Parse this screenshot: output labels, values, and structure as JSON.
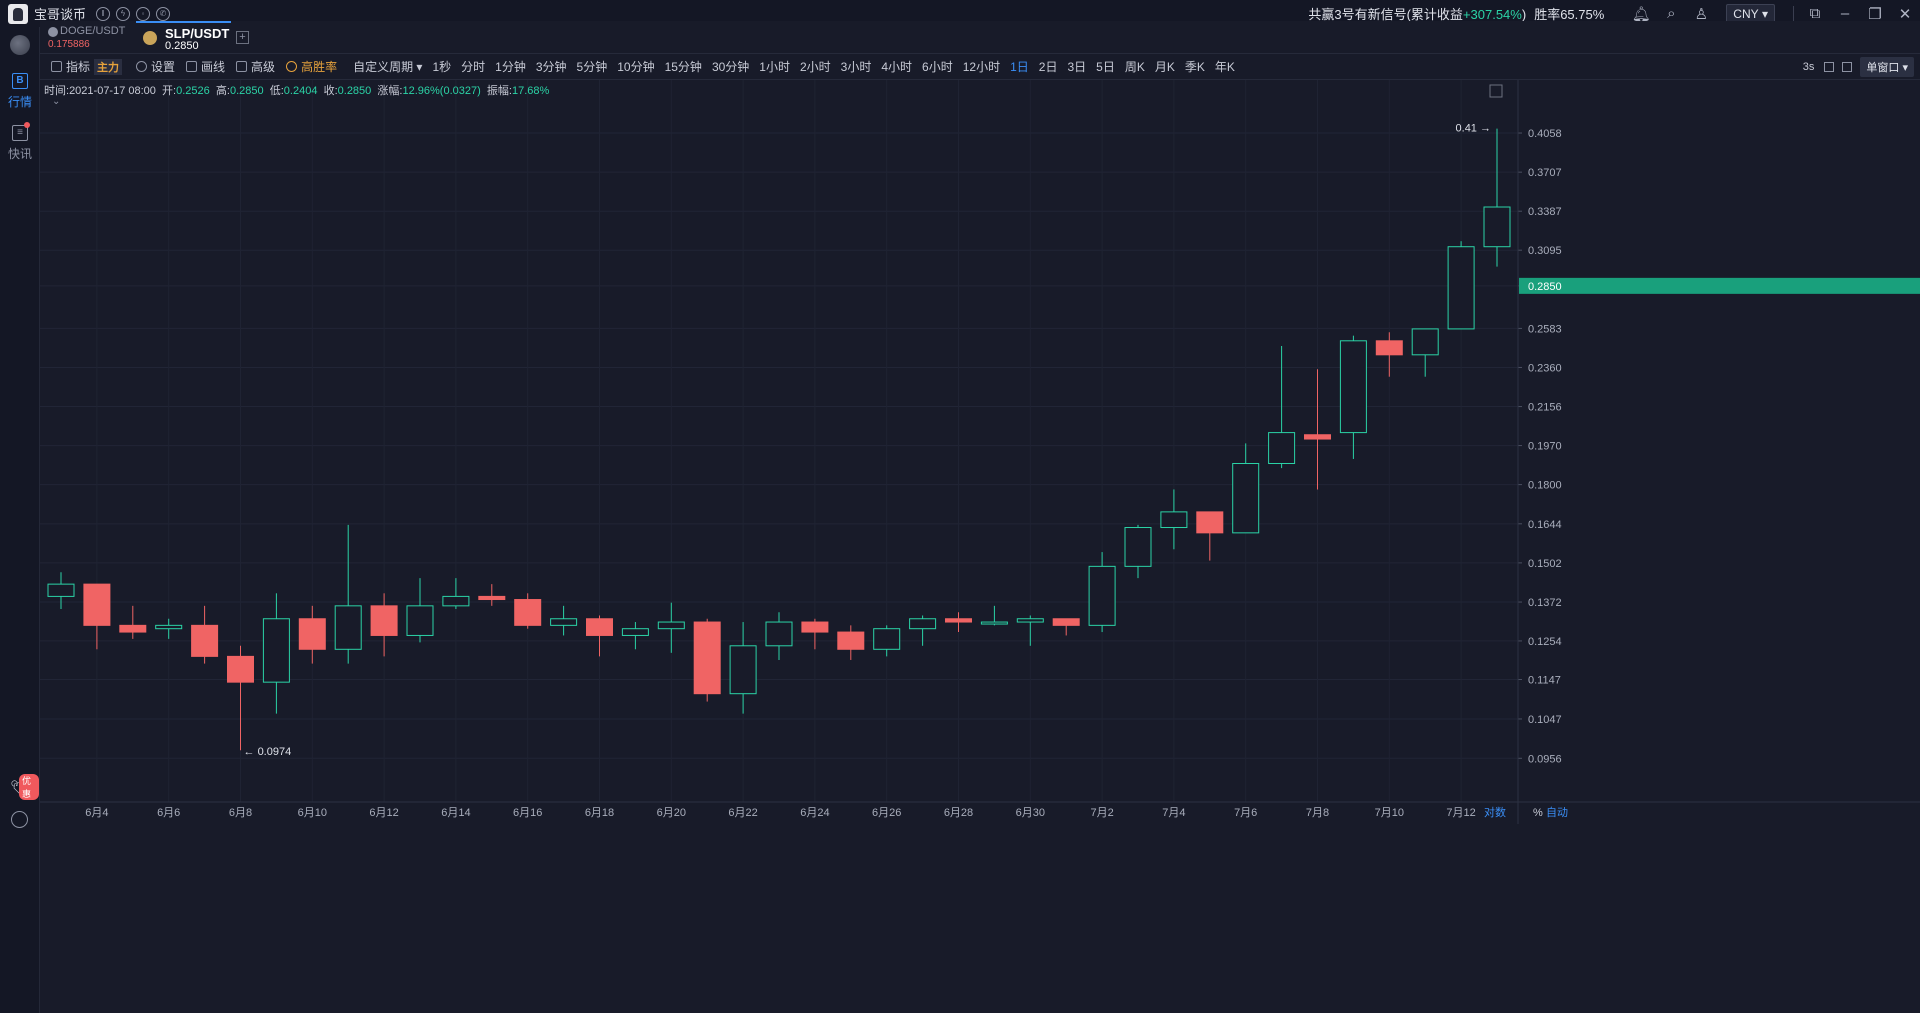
{
  "app": {
    "name": "宝哥谈币",
    "signal_text": "共赢3号有新信号(累计收益",
    "signal_gain": "+307.54%",
    "signal_close": ")",
    "winrate": "胜率65.75%",
    "currency": "CNY"
  },
  "leftnav": {
    "market": "行情",
    "news": "快讯",
    "promo_badge": "优惠"
  },
  "tabs": [
    {
      "symbol": "DOGE/USDT",
      "price": "0.175886"
    },
    {
      "symbol": "SLP/USDT",
      "price": "0.2850"
    }
  ],
  "toolbar": {
    "indicator": "指标",
    "indicator_tag": "主力",
    "settings": "设置",
    "draw": "画线",
    "advanced": "高级",
    "high_win": "高胜率",
    "custom_period": "自定义周期",
    "periods": [
      "1秒",
      "分时",
      "1分钟",
      "3分钟",
      "5分钟",
      "10分钟",
      "15分钟",
      "30分钟",
      "1小时",
      "2小时",
      "3小时",
      "4小时",
      "6小时",
      "12小时",
      "1日",
      "2日",
      "3日",
      "5日",
      "周K",
      "月K",
      "季K",
      "年K"
    ],
    "active_period": "1日",
    "refresh": "3s",
    "window_mode": "单窗口"
  },
  "info": {
    "time_label": "时间:",
    "time": "2021-07-17 08:00",
    "open_label": "开:",
    "open": "0.2526",
    "high_label": "高:",
    "high": "0.2850",
    "low_label": "低:",
    "low": "0.2404",
    "close_label": "收:",
    "close": "0.2850",
    "change_label": "涨幅:",
    "change": "12.96%(0.0327)",
    "amp_label": "振幅:",
    "amp": "17.68%"
  },
  "chart_footer": {
    "log": "对数",
    "pct": "%",
    "auto": "自动"
  },
  "colors": {
    "up": "#2bd3a6",
    "down": "#f06464",
    "accent": "#3a8ef5",
    "gold": "#e6a23c",
    "bg": "#181b29"
  },
  "chart_data": {
    "type": "candlestick",
    "title": "SLP/USDT",
    "last_price": "0.2850",
    "y_ticks": [
      "0.4058",
      "0.3707",
      "0.3387",
      "0.3095",
      "0.2850",
      "0.2583",
      "0.2360",
      "0.2156",
      "0.1970",
      "0.1800",
      "0.1644",
      "0.1502",
      "0.1372",
      "0.1254",
      "0.1147",
      "0.1047",
      "0.0956"
    ],
    "x_ticks": [
      "6月4",
      "6月6",
      "6月8",
      "6月10",
      "6月12",
      "6月14",
      "6月16",
      "6月18",
      "6月20",
      "6月22",
      "6月24",
      "6月26",
      "6月28",
      "6月30",
      "7月2",
      "7月4",
      "7月6",
      "7月8",
      "7月10",
      "7月12"
    ],
    "max_label": "0.41",
    "min_label": "0.0974",
    "scale": "log",
    "candles": [
      {
        "date": "6月3",
        "o": 0.139,
        "h": 0.147,
        "l": 0.135,
        "c": 0.143
      },
      {
        "date": "6月4",
        "o": 0.143,
        "h": 0.143,
        "l": 0.123,
        "c": 0.13
      },
      {
        "date": "6月5",
        "o": 0.13,
        "h": 0.136,
        "l": 0.126,
        "c": 0.128
      },
      {
        "date": "6月6",
        "o": 0.129,
        "h": 0.132,
        "l": 0.126,
        "c": 0.13
      },
      {
        "date": "6月7",
        "o": 0.13,
        "h": 0.136,
        "l": 0.119,
        "c": 0.121
      },
      {
        "date": "6月8",
        "o": 0.121,
        "h": 0.124,
        "l": 0.0974,
        "c": 0.114
      },
      {
        "date": "6月9",
        "o": 0.114,
        "h": 0.14,
        "l": 0.106,
        "c": 0.132
      },
      {
        "date": "6月10",
        "o": 0.132,
        "h": 0.136,
        "l": 0.119,
        "c": 0.123
      },
      {
        "date": "6月11",
        "o": 0.123,
        "h": 0.164,
        "l": 0.119,
        "c": 0.136
      },
      {
        "date": "6月12",
        "o": 0.136,
        "h": 0.14,
        "l": 0.121,
        "c": 0.127
      },
      {
        "date": "6月13",
        "o": 0.127,
        "h": 0.145,
        "l": 0.125,
        "c": 0.136
      },
      {
        "date": "6月14",
        "o": 0.136,
        "h": 0.145,
        "l": 0.135,
        "c": 0.139
      },
      {
        "date": "6月15",
        "o": 0.139,
        "h": 0.143,
        "l": 0.136,
        "c": 0.138
      },
      {
        "date": "6月16",
        "o": 0.138,
        "h": 0.14,
        "l": 0.129,
        "c": 0.13
      },
      {
        "date": "6月17",
        "o": 0.13,
        "h": 0.136,
        "l": 0.127,
        "c": 0.132
      },
      {
        "date": "6月18",
        "o": 0.132,
        "h": 0.133,
        "l": 0.121,
        "c": 0.127
      },
      {
        "date": "6月19",
        "o": 0.127,
        "h": 0.131,
        "l": 0.123,
        "c": 0.129
      },
      {
        "date": "6月20",
        "o": 0.129,
        "h": 0.137,
        "l": 0.122,
        "c": 0.131
      },
      {
        "date": "6月21",
        "o": 0.131,
        "h": 0.132,
        "l": 0.109,
        "c": 0.111
      },
      {
        "date": "6月22",
        "o": 0.111,
        "h": 0.131,
        "l": 0.106,
        "c": 0.124
      },
      {
        "date": "6月23",
        "o": 0.124,
        "h": 0.134,
        "l": 0.12,
        "c": 0.131
      },
      {
        "date": "6月24",
        "o": 0.131,
        "h": 0.132,
        "l": 0.123,
        "c": 0.128
      },
      {
        "date": "6月25",
        "o": 0.128,
        "h": 0.13,
        "l": 0.12,
        "c": 0.123
      },
      {
        "date": "6月26",
        "o": 0.123,
        "h": 0.13,
        "l": 0.121,
        "c": 0.129
      },
      {
        "date": "6月27",
        "o": 0.129,
        "h": 0.133,
        "l": 0.124,
        "c": 0.132
      },
      {
        "date": "6月28",
        "o": 0.132,
        "h": 0.134,
        "l": 0.128,
        "c": 0.131
      },
      {
        "date": "6月29",
        "o": 0.131,
        "h": 0.136,
        "l": 0.13,
        "c": 0.131
      },
      {
        "date": "6月30",
        "o": 0.131,
        "h": 0.133,
        "l": 0.124,
        "c": 0.132
      },
      {
        "date": "7月1",
        "o": 0.132,
        "h": 0.132,
        "l": 0.127,
        "c": 0.13
      },
      {
        "date": "7月2",
        "o": 0.13,
        "h": 0.154,
        "l": 0.128,
        "c": 0.149
      },
      {
        "date": "7月3",
        "o": 0.149,
        "h": 0.164,
        "l": 0.145,
        "c": 0.163
      },
      {
        "date": "7月4",
        "o": 0.163,
        "h": 0.178,
        "l": 0.155,
        "c": 0.169
      },
      {
        "date": "7月5",
        "o": 0.169,
        "h": 0.169,
        "l": 0.151,
        "c": 0.161
      },
      {
        "date": "7月6",
        "o": 0.161,
        "h": 0.198,
        "l": 0.161,
        "c": 0.189
      },
      {
        "date": "7月7",
        "o": 0.189,
        "h": 0.248,
        "l": 0.187,
        "c": 0.203
      },
      {
        "date": "7月8",
        "o": 0.202,
        "h": 0.235,
        "l": 0.178,
        "c": 0.2
      },
      {
        "date": "7月9",
        "o": 0.203,
        "h": 0.254,
        "l": 0.191,
        "c": 0.251
      },
      {
        "date": "7月10",
        "o": 0.251,
        "h": 0.256,
        "l": 0.231,
        "c": 0.243
      },
      {
        "date": "7月11",
        "o": 0.243,
        "h": 0.258,
        "l": 0.231,
        "c": 0.258
      },
      {
        "date": "7月12",
        "o": 0.258,
        "h": 0.316,
        "l": 0.258,
        "c": 0.312
      },
      {
        "date": "7月13",
        "o": 0.312,
        "h": 0.41,
        "l": 0.298,
        "c": 0.342
      }
    ]
  }
}
